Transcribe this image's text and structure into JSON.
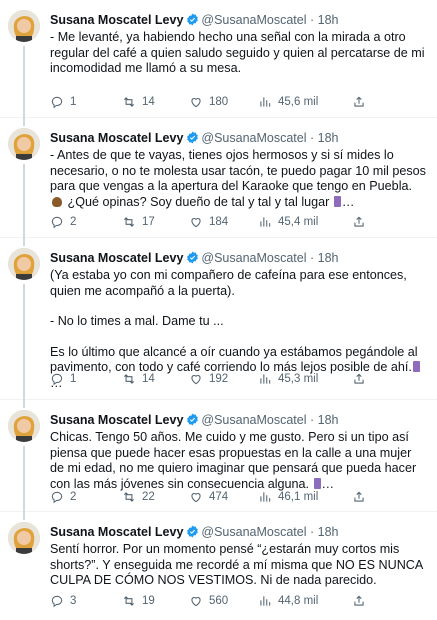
{
  "author": {
    "name": "Susana Moscatel Levy",
    "handle": "@SusanaMoscatel",
    "separator": "·"
  },
  "tweets": [
    {
      "time": "18h",
      "paragraphs": [
        "- Me levanté, ya habiendo hecho una señal con la mirada a otro regular del café a quien saludo seguido y quien al percatarse de mi incomodidad me llamó a su mesa."
      ],
      "stats": {
        "replies": "1",
        "retweets": "14",
        "likes": "180",
        "views": "45,6 mil"
      }
    },
    {
      "time": "18h",
      "paragraphs": [
        "- Antes de que te vayas, tienes ojos hermosos y si sí mides lo necesario, o no te molesta usar tacón, te puedo pagar 10 mil pesos para que vengas a la apertura del Karaoke que tengo en Puebla.",
        "¿Qué opinas? Soy dueño de tal y tal y tal lugar",
        "…"
      ],
      "stats": {
        "replies": "2",
        "retweets": "17",
        "likes": "184",
        "views": "45,4 mil"
      }
    },
    {
      "time": "18h",
      "paragraphs": [
        "(Ya estaba yo con mi compañero de cafeína para ese entonces, quien me acompañó a la puerta).",
        "- No lo times a mal. Dame tu ...",
        "Es lo último que alcancé a oír cuando ya estábamos pegándole al pavimento, con todo y café corriendo lo más lejos posible de ahí.",
        "…"
      ],
      "stats": {
        "replies": "1",
        "retweets": "14",
        "likes": "192",
        "views": "45,3 mil"
      }
    },
    {
      "time": "18h",
      "paragraphs": [
        "Chicas. Tengo 50 años. Me cuido y me gusto. Pero si un tipo así piensa que puede hacer esas propuestas en la calle a una mujer de mi edad, no me quiero imaginar que pensará que pueda hacer con las más jóvenes sin consecuencia alguna.",
        "…"
      ],
      "stats": {
        "replies": "2",
        "retweets": "22",
        "likes": "474",
        "views": "46,1 mil"
      }
    },
    {
      "time": "18h",
      "paragraphs": [
        "Sentí horror. Por un momento pensé “¿estarán muy cortos mis shorts?”. Y enseguida me recordé a mí misma que NO ES NUNCA CULPA DE CÓMO NOS VESTIMOS. Ni de nada parecido."
      ],
      "stats": {
        "replies": "3",
        "retweets": "19",
        "likes": "560",
        "views": "44,8 mil"
      }
    }
  ],
  "colors": {
    "accent": "#1d9bf0",
    "muted": "#536471",
    "text": "#0f1419",
    "border": "#eff3f4"
  }
}
